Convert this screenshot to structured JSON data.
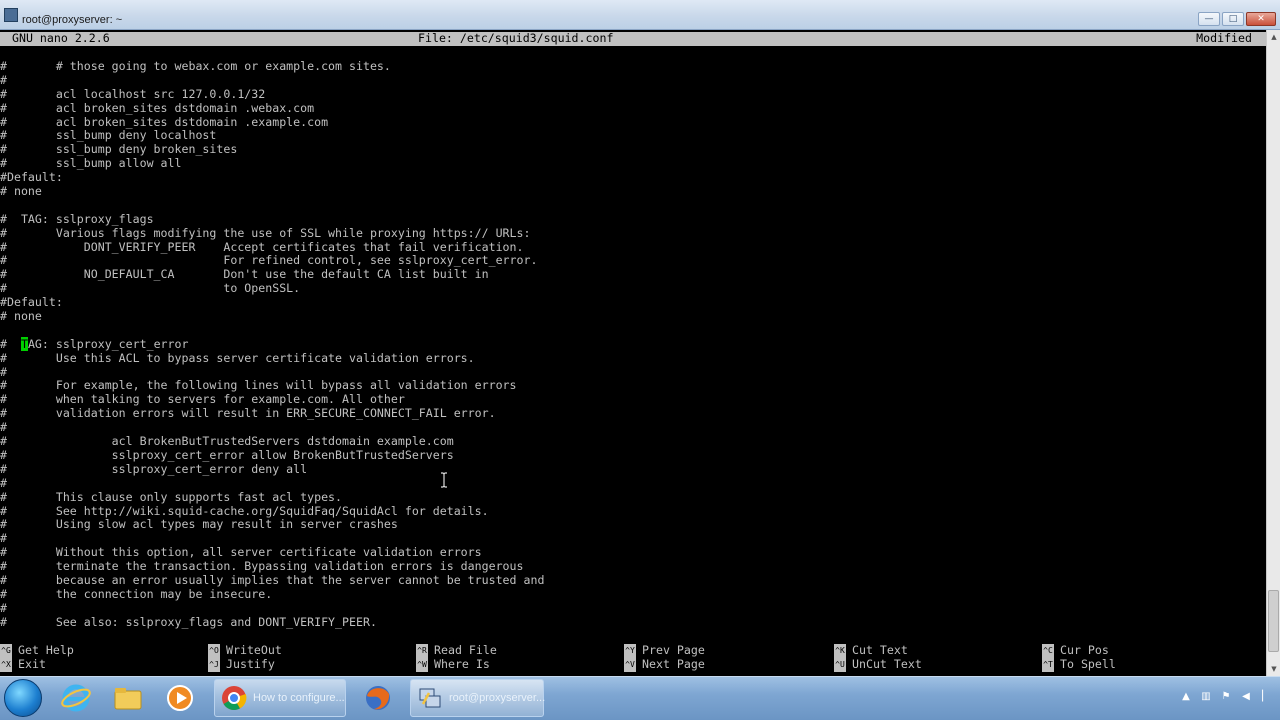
{
  "window": {
    "title": "root@proxyserver: ~",
    "buttons": [
      "minimize",
      "maximize",
      "close"
    ]
  },
  "nano": {
    "version": "GNU nano 2.2.6",
    "file_label": "File: /etc/squid3/squid.conf",
    "status": "Modified"
  },
  "editor_lines": [
    "#       # those going to webax.com or example.com sites.",
    "#",
    "#       acl localhost src 127.0.0.1/32",
    "#       acl broken_sites dstdomain .webax.com",
    "#       acl broken_sites dstdomain .example.com",
    "#       ssl_bump deny localhost",
    "#       ssl_bump deny broken_sites",
    "#       ssl_bump allow all",
    "#Default:",
    "# none",
    "",
    "#  TAG: sslproxy_flags",
    "#       Various flags modifying the use of SSL while proxying https:// URLs:",
    "#           DONT_VERIFY_PEER    Accept certificates that fail verification.",
    "#                               For refined control, see sslproxy_cert_error.",
    "#           NO_DEFAULT_CA       Don't use the default CA list built in",
    "#                               to OpenSSL.",
    "#Default:",
    "# none",
    "",
    "#  TAG: sslproxy_cert_error",
    "#       Use this ACL to bypass server certificate validation errors.",
    "#",
    "#       For example, the following lines will bypass all validation errors",
    "#       when talking to servers for example.com. All other",
    "#       validation errors will result in ERR_SECURE_CONNECT_FAIL error.",
    "#",
    "#               acl BrokenButTrustedServers dstdomain example.com",
    "#               sslproxy_cert_error allow BrokenButTrustedServers",
    "#               sslproxy_cert_error deny all",
    "#",
    "#       This clause only supports fast acl types.",
    "#       See http://wiki.squid-cache.org/SquidFaq/SquidAcl for details.",
    "#       Using slow acl types may result in server crashes",
    "#",
    "#       Without this option, all server certificate validation errors",
    "#       terminate the transaction. Bypassing validation errors is dangerous",
    "#       because an error usually implies that the server cannot be trusted and",
    "#       the connection may be insecure.",
    "#",
    "#       See also: sslproxy_flags and DONT_VERIFY_PEER."
  ],
  "cursor_line": {
    "before": "#  ",
    "char": "T",
    "after": "AG: sslproxy_cert_error"
  },
  "shortcuts": [
    {
      "key": "^G",
      "label": "Get Help"
    },
    {
      "key": "^X",
      "label": "Exit"
    },
    {
      "key": "^O",
      "label": "WriteOut"
    },
    {
      "key": "^J",
      "label": "Justify"
    },
    {
      "key": "^R",
      "label": "Read File"
    },
    {
      "key": "^W",
      "label": "Where Is"
    },
    {
      "key": "^Y",
      "label": "Prev Page"
    },
    {
      "key": "^V",
      "label": "Next Page"
    },
    {
      "key": "^K",
      "label": "Cut Text"
    },
    {
      "key": "^U",
      "label": "UnCut Text"
    },
    {
      "key": "^C",
      "label": "Cur Pos"
    },
    {
      "key": "^T",
      "label": "To Spell"
    }
  ],
  "taskbar": {
    "tasks": [
      {
        "name": "chrome",
        "label": "How to configure..."
      },
      {
        "name": "putty",
        "label": "root@proxyserver..."
      }
    ],
    "pinned": [
      "ie-icon",
      "explorer-icon",
      "media-player-icon",
      "firefox-icon"
    ]
  },
  "colors": {
    "terminal_bg": "#000000",
    "terminal_fg": "#c0c0c0",
    "cursor": "#00d000",
    "header_bg": "#c0c0c0"
  }
}
